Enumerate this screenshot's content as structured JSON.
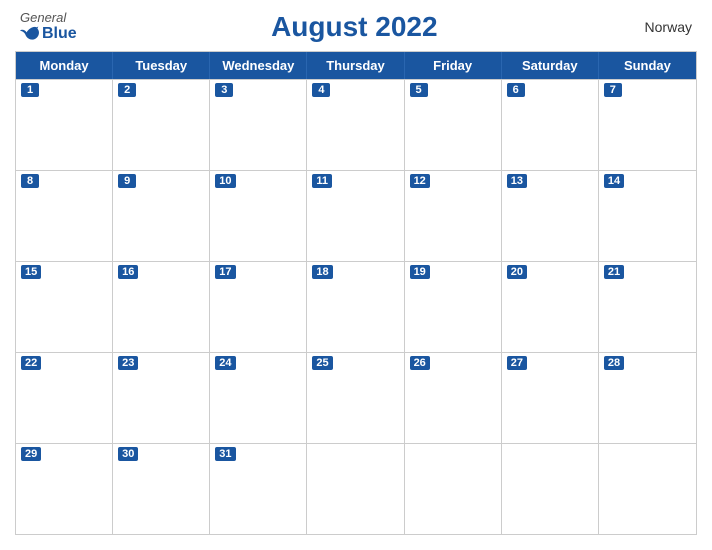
{
  "header": {
    "logo_general": "General",
    "logo_blue": "Blue",
    "title": "August 2022",
    "country": "Norway"
  },
  "days": {
    "headers": [
      "Monday",
      "Tuesday",
      "Wednesday",
      "Thursday",
      "Friday",
      "Saturday",
      "Sunday"
    ]
  },
  "weeks": [
    [
      1,
      2,
      3,
      4,
      5,
      6,
      7
    ],
    [
      8,
      9,
      10,
      11,
      12,
      13,
      14
    ],
    [
      15,
      16,
      17,
      18,
      19,
      20,
      21
    ],
    [
      22,
      23,
      24,
      25,
      26,
      27,
      28
    ],
    [
      29,
      30,
      31,
      null,
      null,
      null,
      null
    ]
  ]
}
